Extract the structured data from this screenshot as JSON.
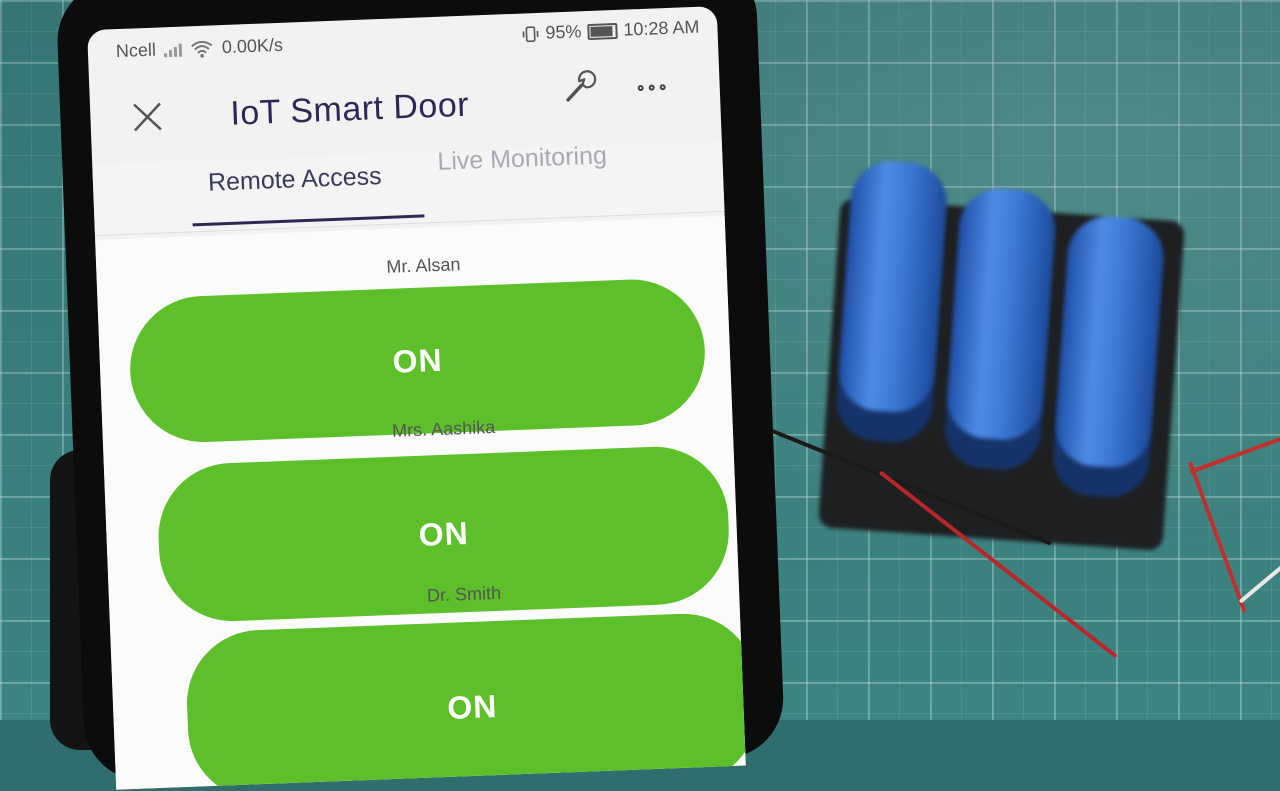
{
  "status_bar": {
    "carrier": "Ncell",
    "network_speed": "0.00K/s",
    "battery_percent": "95%",
    "time": "10:28 AM"
  },
  "header": {
    "title": "IoT Smart Door",
    "close_icon": "close-icon",
    "settings_icon": "wrench-icon",
    "more_icon": "more-icon"
  },
  "tabs": [
    {
      "label": "Remote Access",
      "active": true
    },
    {
      "label": "Live Monitoring",
      "active": false
    }
  ],
  "controls": [
    {
      "label": "Mr. Alsan",
      "state": "ON"
    },
    {
      "label": "Mrs. Aashika",
      "state": "ON"
    },
    {
      "label": "Dr. Smith",
      "state": "ON"
    }
  ],
  "colors": {
    "accent": "#2c2a55",
    "on_button": "#5dc02b"
  }
}
